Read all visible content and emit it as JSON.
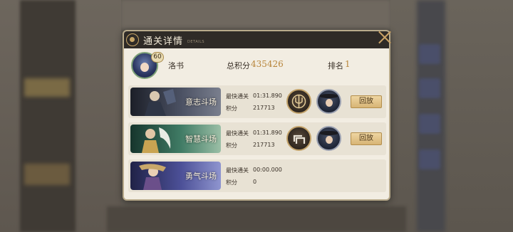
{
  "panel": {
    "title": "通关详情",
    "subtitle": "DETAILS"
  },
  "player": {
    "level": "60",
    "name": "洛书",
    "score_label": "总积分",
    "score_value": "435426",
    "rank_label": "排名",
    "rank_value": "1"
  },
  "arenas": [
    {
      "name": "意志斗场",
      "fastest_label": "最快通关",
      "fastest_time": "01:31.890",
      "score_label": "积分",
      "score": "217713",
      "has_replay": true,
      "replay_label": "回放",
      "banner_colors": [
        "#2a2f3a",
        "#5b6275"
      ]
    },
    {
      "name": "智慧斗场",
      "fastest_label": "最快通关",
      "fastest_time": "01:31.890",
      "score_label": "积分",
      "score": "217713",
      "has_replay": true,
      "replay_label": "回放",
      "banner_colors": [
        "#1f4a3c",
        "#4e8870"
      ]
    },
    {
      "name": "勇气斗场",
      "fastest_label": "最快通关",
      "fastest_time": "00:00.000",
      "score_label": "积分",
      "score": "0",
      "has_replay": false,
      "replay_label": "",
      "banner_colors": [
        "#2c2d5e",
        "#6a6fb2"
      ]
    }
  ],
  "colors": {
    "header_bg": "#2f2b27",
    "panel_bg": "#f2ede2",
    "accent_gold": "#b8853a",
    "button_gold": "#d7b475"
  }
}
